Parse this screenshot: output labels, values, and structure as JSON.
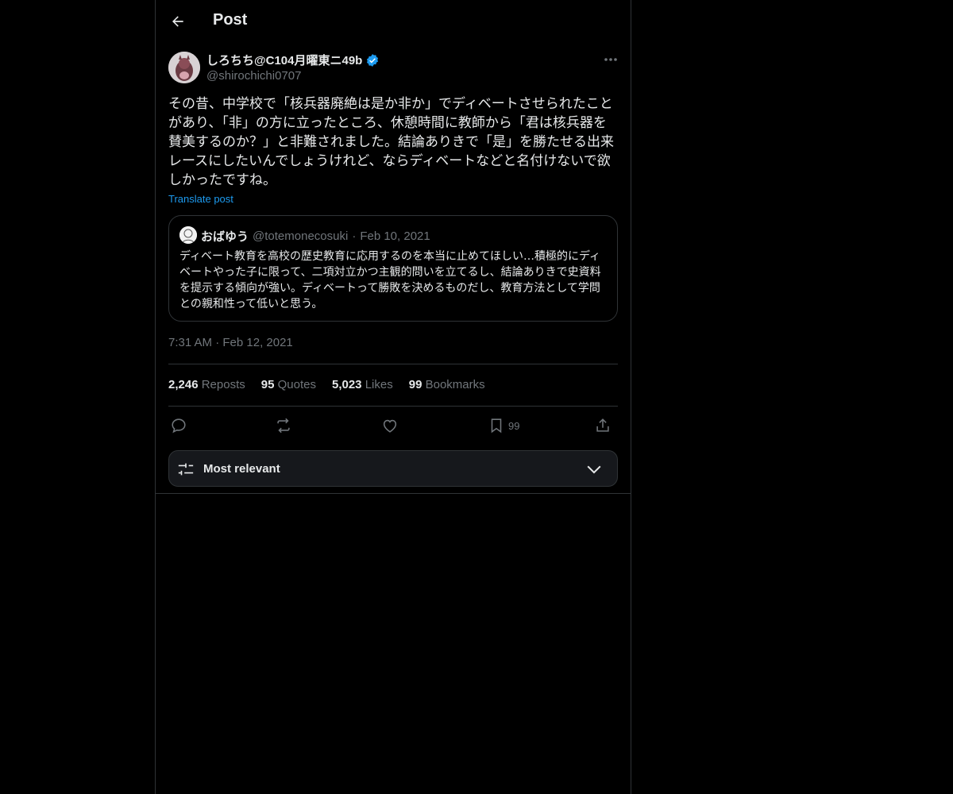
{
  "header": {
    "title": "Post"
  },
  "author": {
    "name": "しろちち@C104月曜東ニ49b",
    "handle": "@shirochichi0707",
    "verified": true
  },
  "post": {
    "text": "その昔、中学校で「核兵器廃絶は是か非か」でディベートさせられたことがあり、「非」の方に立ったところ、休憩時間に教師から「君は核兵器を賛美するのか？」と非難されました。結論ありきで「是」を勝たせる出来レースにしたいんでしょうけれど、ならディベートなどと名付けないで欲しかったですね。",
    "translate_label": "Translate post",
    "timestamp": "7:31 AM · Feb 12, 2021"
  },
  "quote": {
    "name": "おばゆう",
    "handle": "@totemonecosuki",
    "dot": "·",
    "date": "Feb 10, 2021",
    "text": "ディベート教育を高校の歴史教育に応用するのを本当に止めてほしい…積極的にディベートやった子に限って、二項対立かつ主観的問いを立てるし、結論ありきで史資料を提示する傾向が強い。ディベートって勝敗を決めるものだし、教育方法として学問との親和性って低いと思う。"
  },
  "stats": {
    "reposts_count": "2,246",
    "reposts_label": "Reposts",
    "quotes_count": "95",
    "quotes_label": "Quotes",
    "likes_count": "5,023",
    "likes_label": "Likes",
    "bookmarks_count": "99",
    "bookmarks_label": "Bookmarks"
  },
  "actions": {
    "bookmark_count": "99"
  },
  "filter": {
    "label": "Most relevant"
  },
  "colors": {
    "background": "#000000",
    "text": "#e7e9ea",
    "muted": "#71767b",
    "accent": "#1d9bf0",
    "border": "#2f3336"
  }
}
